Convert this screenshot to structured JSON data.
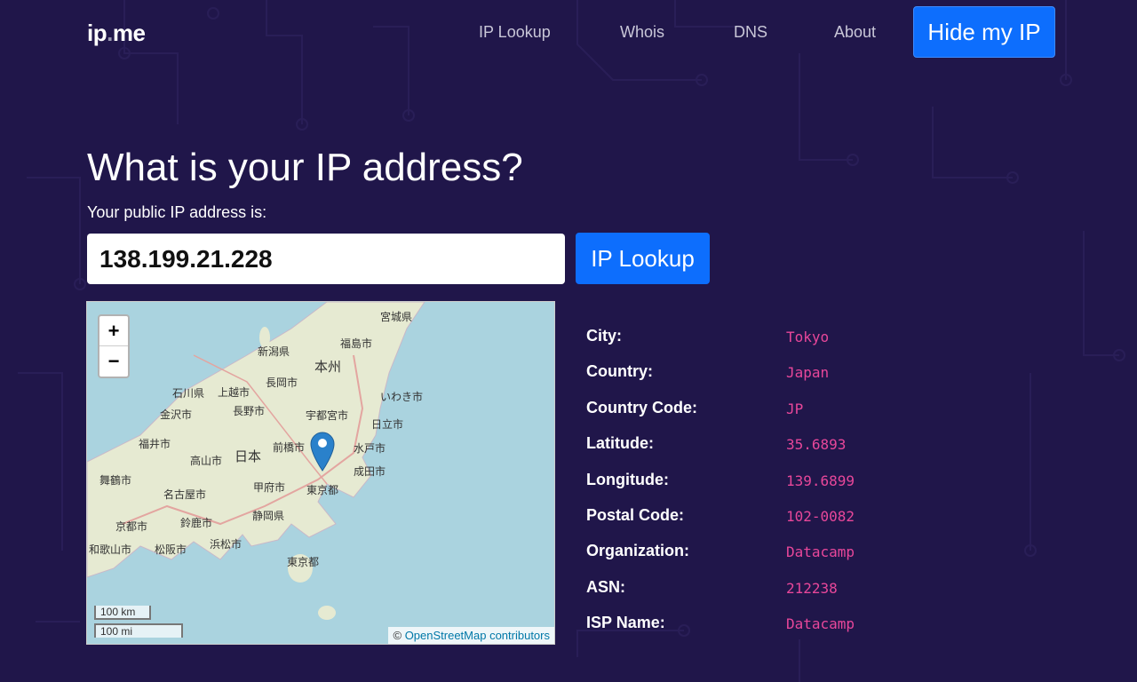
{
  "nav": {
    "logo_a": "ip",
    "logo_dot": ".",
    "logo_b": "me",
    "links": [
      "IP Lookup",
      "Whois",
      "DNS",
      "About"
    ],
    "hide_button": "Hide my IP"
  },
  "main": {
    "title": "What is your IP address?",
    "subtitle": "Your public IP address is:",
    "ip": "138.199.21.228",
    "lookup_button": "IP Lookup"
  },
  "map": {
    "zoom_in": "+",
    "zoom_out": "−",
    "scale_km": "100 km",
    "scale_mi": "100 mi",
    "attribution_prefix": "©",
    "attribution_link": "OpenStreetMap contributors",
    "labels": [
      "宮城県",
      "福島市",
      "新潟県",
      "本州",
      "長岡市",
      "上越市",
      "石川県",
      "金沢市",
      "長野市",
      "宇都宮市",
      "いわき市",
      "日立市",
      "福井市",
      "高山市",
      "日本",
      "前橋市",
      "水戸市",
      "成田市",
      "舞鶴市",
      "名古屋市",
      "甲府市",
      "東京都",
      "京都市",
      "鈴鹿市",
      "静岡県",
      "和歌山市",
      "松阪市",
      "浜松市",
      "東京都"
    ]
  },
  "info": [
    {
      "k": "City:",
      "v": "Tokyo"
    },
    {
      "k": "Country:",
      "v": "Japan"
    },
    {
      "k": "Country Code:",
      "v": "JP"
    },
    {
      "k": "Latitude:",
      "v": "35.6893"
    },
    {
      "k": "Longitude:",
      "v": "139.6899"
    },
    {
      "k": "Postal Code:",
      "v": "102-0082"
    },
    {
      "k": "Organization:",
      "v": "Datacamp"
    },
    {
      "k": "ASN:",
      "v": "212238"
    },
    {
      "k": "ISP Name:",
      "v": "Datacamp"
    }
  ],
  "colors": {
    "background": "#20164a",
    "accent": "#0d6efd",
    "value": "#e8479a"
  }
}
